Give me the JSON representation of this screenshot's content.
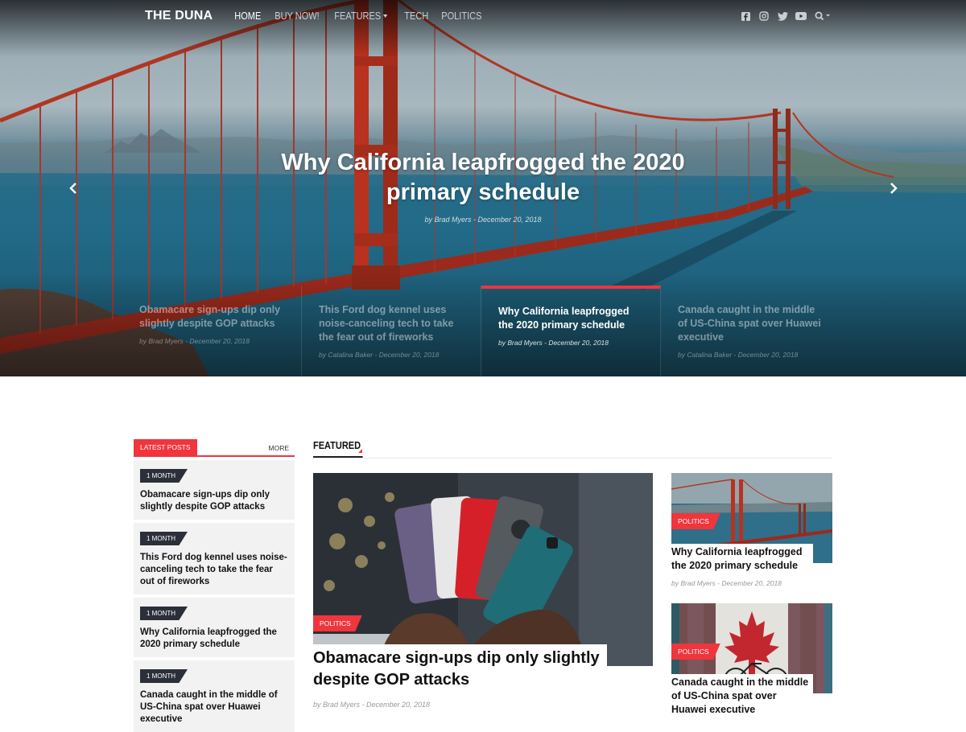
{
  "nav": {
    "logo": "THE DUNA",
    "items": [
      {
        "label": "HOME",
        "active": true,
        "dropdown": false
      },
      {
        "label": "BUY NOW!",
        "active": false,
        "dropdown": false
      },
      {
        "label": "FEATURES",
        "active": false,
        "dropdown": true
      },
      {
        "label": "TECH",
        "active": false,
        "dropdown": false
      },
      {
        "label": "POLITICS",
        "active": false,
        "dropdown": false
      }
    ],
    "social_icons": [
      "facebook-icon",
      "instagram-icon",
      "twitter-icon",
      "youtube-icon",
      "search-icon"
    ]
  },
  "hero": {
    "title": "Why California leapfrogged the 2020 primary schedule",
    "meta": "by Brad Myers  -  December 20, 2018",
    "slides": [
      {
        "title": "Obamacare sign-ups dip only slightly despite GOP attacks",
        "meta": "by Brad Myers  -  December 20, 2018",
        "active": false
      },
      {
        "title": "This Ford dog kennel uses noise-canceling tech to take the fear out of fireworks",
        "meta": "by Catalina Baker  -  December 20, 2018",
        "active": false
      },
      {
        "title": "Why California leapfrogged the 2020 primary schedule",
        "meta": "by Brad Myers  -  December 20, 2018",
        "active": true
      },
      {
        "title": "Canada caught in the middle of US-China spat over Huawei executive",
        "meta": "by Catalina Baker  -  December 20, 2018",
        "active": false
      }
    ]
  },
  "sidebar": {
    "tag": "LATEST POSTS",
    "more": "MORE",
    "items": [
      {
        "age": "1 MONTH",
        "title": "Obamacare sign-ups dip only slightly despite GOP attacks"
      },
      {
        "age": "1 MONTH",
        "title": "This Ford dog kennel uses noise-canceling tech to take the fear out of fireworks"
      },
      {
        "age": "1 MONTH",
        "title": "Why California leapfrogged the 2020 primary schedule"
      },
      {
        "age": "1 MONTH",
        "title": "Canada caught in the middle of US-China spat over Huawei executive"
      }
    ]
  },
  "featured": {
    "label": "FEATURED",
    "main": {
      "category": "POLITICS",
      "title": "Obamacare sign-ups dip only slightly despite GOP attacks",
      "meta": "by Brad Myers  -  December 20, 2018"
    },
    "side": [
      {
        "category": "POLITICS",
        "title": "Why California leapfrogged the 2020 primary schedule",
        "meta": "by Brad Myers  -  December 20, 2018"
      },
      {
        "category": "POLITICS",
        "title": "Canada caught in the middle of US-China spat over Huawei executive",
        "meta": ""
      }
    ]
  },
  "colors": {
    "accent": "#f0353d",
    "dark": "#2b2f3a"
  }
}
